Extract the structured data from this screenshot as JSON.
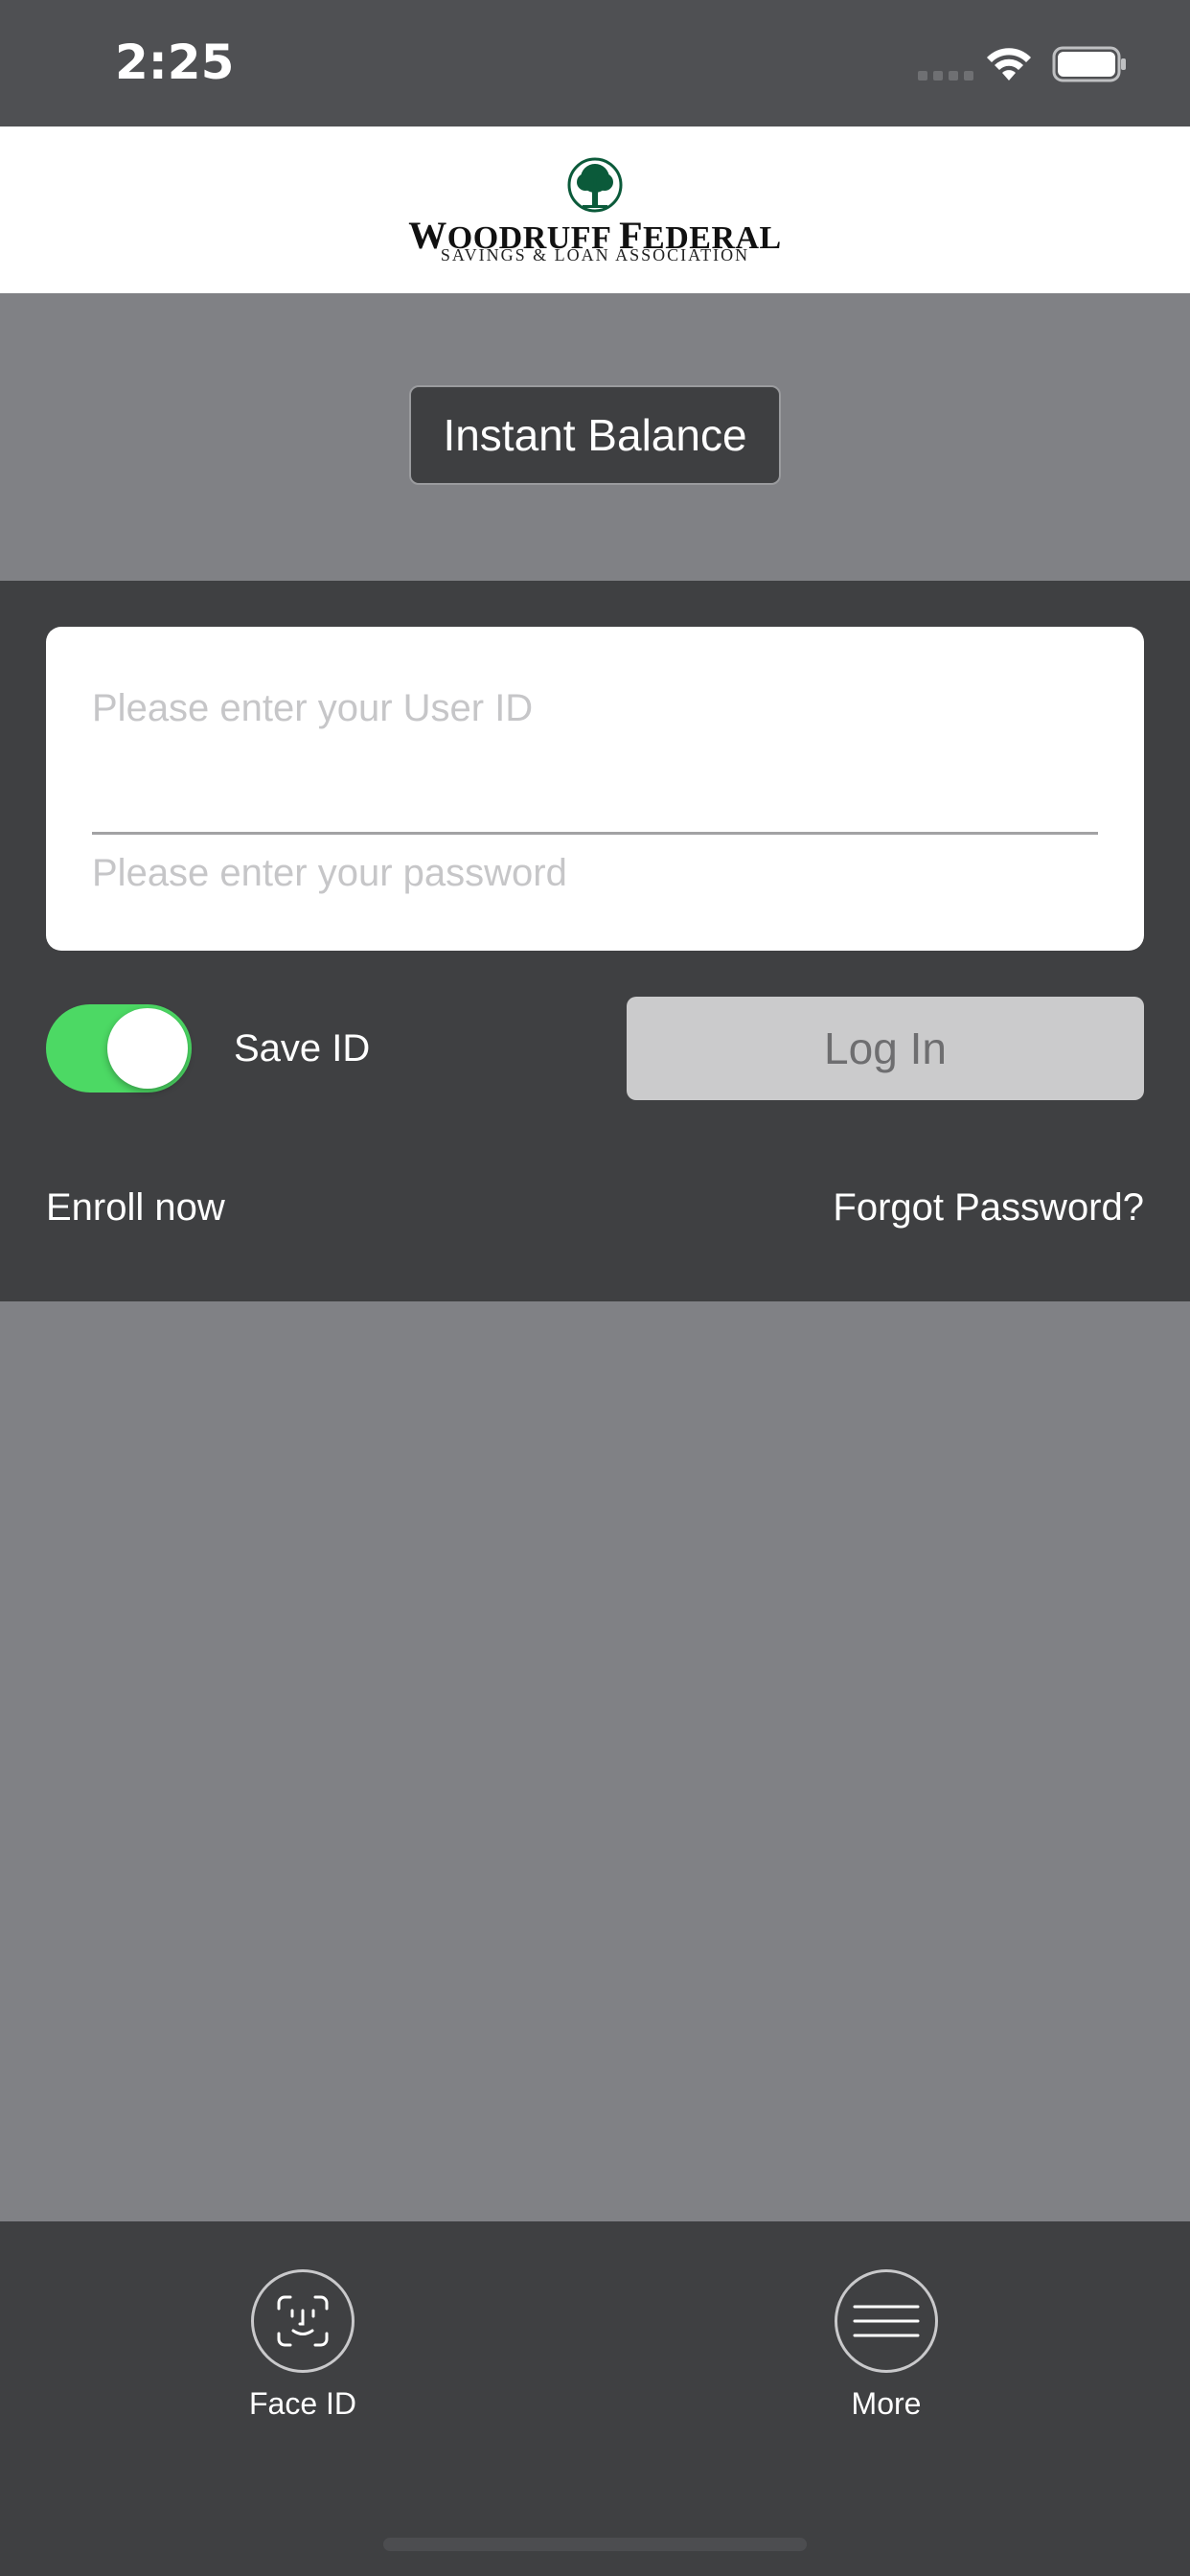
{
  "status_bar": {
    "time": "2:25",
    "icons": [
      "signal-icon",
      "wifi-icon",
      "battery-icon"
    ]
  },
  "header": {
    "logo_icon": "tree-icon",
    "logo_name_first": "W",
    "logo_name_rest1": "OODRUFF ",
    "logo_name_first2": "F",
    "logo_name_rest2": "EDERAL",
    "logo_tagline": "SAVINGS & LOAN ASSOCIATION",
    "brand_color": "#0b5a3a"
  },
  "instant_balance": {
    "label": "Instant Balance"
  },
  "login_form": {
    "userid_placeholder": "Please enter your User ID",
    "userid_value": "",
    "password_placeholder": "Please enter your password",
    "password_value": "",
    "save_id_label": "Save ID",
    "save_id_on": true,
    "login_label": "Log In",
    "enroll_label": "Enroll now",
    "forgot_label": "Forgot Password?"
  },
  "tab_bar": {
    "items": [
      {
        "label": "Face ID",
        "icon": "face-id-icon"
      },
      {
        "label": "More",
        "icon": "menu-icon"
      }
    ]
  },
  "colors": {
    "toggle_on": "#4cd964",
    "panel": "#3f4042",
    "background": "#808185"
  }
}
